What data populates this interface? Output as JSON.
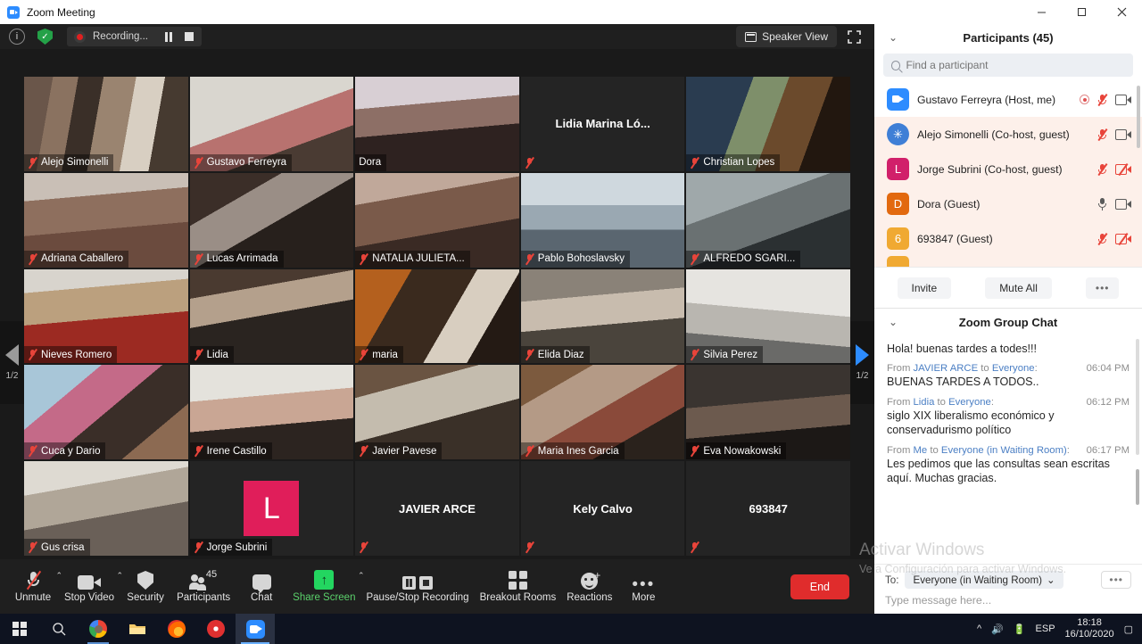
{
  "window": {
    "title": "Zoom Meeting",
    "minimize_icon": "minimize-icon",
    "maximize_icon": "maximize-icon",
    "close_icon": "close-icon"
  },
  "header": {
    "info_icon": "info-icon",
    "encryption_icon": "shield-icon",
    "recording_label": "Recording...",
    "pause_icon": "pause-recording-icon",
    "stop_icon": "stop-recording-icon",
    "view_label": "Speaker View",
    "fullscreen_icon": "fullscreen-icon"
  },
  "gallery": {
    "page_indicator": "1/2",
    "prev_icon": "previous-page-arrow",
    "next_icon": "next-page-arrow",
    "tiles": [
      {
        "name": "Alejo Simonelli",
        "muted": true,
        "video": true,
        "active": false,
        "style": "bookshelf"
      },
      {
        "name": "Gustavo Ferreyra",
        "muted": true,
        "video": true,
        "active": false,
        "style": "pinkshirt"
      },
      {
        "name": "Dora",
        "muted": false,
        "video": true,
        "active": true,
        "style": "dora"
      },
      {
        "name": "Lidia  Marina Ló...",
        "muted": true,
        "video": false,
        "active": false,
        "style": "none"
      },
      {
        "name": "Christian Lopes",
        "muted": true,
        "video": true,
        "active": false,
        "style": "map"
      },
      {
        "name": "Adriana Caballero",
        "muted": true,
        "video": true,
        "active": false,
        "style": "adriana"
      },
      {
        "name": "Lucas Arrimada",
        "muted": true,
        "video": true,
        "active": false,
        "style": "lucas"
      },
      {
        "name": "NATALIA JULIETA...",
        "muted": true,
        "video": true,
        "active": false,
        "style": "natalia"
      },
      {
        "name": "Pablo Bohoslavsky",
        "muted": true,
        "video": true,
        "active": false,
        "style": "pablo"
      },
      {
        "name": "ALFREDO SGARI...",
        "muted": true,
        "video": true,
        "active": false,
        "style": "alfredo"
      },
      {
        "name": "Nieves Romero",
        "muted": true,
        "video": true,
        "active": false,
        "style": "nieves"
      },
      {
        "name": "Lidia",
        "muted": true,
        "video": true,
        "active": false,
        "style": "lidia"
      },
      {
        "name": "maria",
        "muted": true,
        "video": true,
        "active": false,
        "style": "maria"
      },
      {
        "name": "Elida Diaz",
        "muted": true,
        "video": true,
        "active": false,
        "style": "elida"
      },
      {
        "name": "Silvia Perez",
        "muted": true,
        "video": true,
        "active": false,
        "style": "silvia"
      },
      {
        "name": "Cuca y Dario",
        "muted": true,
        "video": true,
        "active": false,
        "style": "cuca"
      },
      {
        "name": "Irene Castillo",
        "muted": true,
        "video": true,
        "active": false,
        "style": "irene"
      },
      {
        "name": "Javier Pavese",
        "muted": true,
        "video": true,
        "active": false,
        "style": "javierp"
      },
      {
        "name": "Maria Ines Garcia",
        "muted": true,
        "video": true,
        "active": false,
        "style": "mariaines"
      },
      {
        "name": "Eva Nowakowski",
        "muted": true,
        "video": true,
        "active": false,
        "style": "eva"
      },
      {
        "name": "Gus crisa",
        "muted": true,
        "video": true,
        "active": false,
        "style": "gus"
      },
      {
        "name": "Jorge Subrini",
        "muted": true,
        "video": false,
        "active": false,
        "style": "avatar-L",
        "avatar_letter": "L",
        "avatar_color": "#e01e5a"
      },
      {
        "name": "JAVIER ARCE",
        "muted": true,
        "video": false,
        "active": false,
        "style": "none"
      },
      {
        "name": "Kely Calvo",
        "muted": true,
        "video": false,
        "active": false,
        "style": "none"
      },
      {
        "name": "693847",
        "muted": true,
        "video": false,
        "active": false,
        "style": "none"
      }
    ]
  },
  "controls": [
    {
      "label": "Unmute",
      "icon": "microphone-muted-icon",
      "caret": true
    },
    {
      "label": "Stop Video",
      "icon": "camera-icon",
      "caret": true
    },
    {
      "label": "Security",
      "icon": "shield-icon",
      "caret": false
    },
    {
      "label": "Participants",
      "icon": "participants-icon",
      "caret": false,
      "badge": "45"
    },
    {
      "label": "Chat",
      "icon": "chat-bubble-icon",
      "caret": false
    },
    {
      "label": "Share Screen",
      "icon": "share-screen-icon",
      "caret": true
    },
    {
      "label": "Pause/Stop Recording",
      "icon": "pause-stop-recording-icon",
      "caret": false
    },
    {
      "label": "Breakout Rooms",
      "icon": "breakout-rooms-icon",
      "caret": false
    },
    {
      "label": "Reactions",
      "icon": "reactions-icon",
      "caret": false
    },
    {
      "label": "More",
      "icon": "more-dots-icon",
      "caret": false
    }
  ],
  "end_button": "End",
  "participants_panel": {
    "title": "Participants (45)",
    "collapse_icon": "chevron-down-icon",
    "search_placeholder": "Find a participant",
    "search_value": "",
    "search_icon": "search-icon",
    "rows": [
      {
        "avatar": "zoom-logo",
        "avatar_letter": "",
        "avatar_color": "#2d8cff",
        "name": "Gustavo Ferreyra  (Host, me)",
        "recording": true,
        "mic": "muted",
        "cam": "on",
        "me": true
      },
      {
        "avatar": "snowflake",
        "avatar_letter": "",
        "avatar_color": "#3f7fd6",
        "name": "Alejo Simonelli (Co-host, guest)",
        "recording": false,
        "mic": "muted",
        "cam": "on",
        "me": false
      },
      {
        "avatar": "letter",
        "avatar_letter": "L",
        "avatar_color": "#d1206a",
        "name": "Jorge Subrini (Co-host, guest)",
        "recording": false,
        "mic": "muted",
        "cam": "off",
        "me": false
      },
      {
        "avatar": "letter",
        "avatar_letter": "D",
        "avatar_color": "#e2690f",
        "name": "Dora (Guest)",
        "recording": false,
        "mic": "on",
        "cam": "on",
        "me": false
      },
      {
        "avatar": "letter",
        "avatar_letter": "6",
        "avatar_color": "#f0a932",
        "name": "693847 (Guest)",
        "recording": false,
        "mic": "muted",
        "cam": "off",
        "me": false
      }
    ],
    "buttons": {
      "invite": "Invite",
      "mute_all": "Mute All",
      "more": "•••"
    }
  },
  "chat_panel": {
    "title": "Zoom Group Chat",
    "collapse_icon": "chevron-down-icon",
    "first_line": "Hola! buenas tardes a todes!!!",
    "messages": [
      {
        "prefix": "From ",
        "sender": "JAVIER ARCE",
        "mid": " to ",
        "target": "Everyone",
        "suffix": ":",
        "time": "06:04 PM",
        "text": "BUENAS TARDES A TODOS.."
      },
      {
        "prefix": "From ",
        "sender": "Lidia",
        "mid": " to ",
        "target": "Everyone",
        "suffix": ":",
        "time": "06:12 PM",
        "text": "siglo XIX liberalismo económico y conservadurismo político"
      },
      {
        "prefix": "From ",
        "sender": "Me",
        "mid": " to ",
        "target": "Everyone (in Waiting Room)",
        "suffix": ":",
        "time": "06:17 PM",
        "text": "Les pedimos que las consultas sean escritas aquí.  Muchas gracias."
      }
    ],
    "to_label": "To:",
    "to_value": "Everyone (in Waiting Room)",
    "to_caret_icon": "chevron-down-icon",
    "more_icon": "more-dots-icon",
    "input_placeholder": "Type message here..."
  },
  "watermark": {
    "line1": "Activar Windows",
    "line2": "Ve a Configuración para activar Windows."
  },
  "taskbar": {
    "start_icon": "windows-start-icon",
    "search_icon": "search-icon",
    "apps": [
      {
        "icon": "chrome-icon",
        "running": true
      },
      {
        "icon": "file-explorer-icon",
        "running": false
      },
      {
        "icon": "firefox-icon",
        "running": false
      },
      {
        "icon": "media-player-icon",
        "running": false
      },
      {
        "icon": "zoom-icon",
        "running": true
      }
    ],
    "tray": {
      "chevron_icon": "show-hidden-icons",
      "volume_icon": "volume-icon",
      "network_icon": "network-battery-icon",
      "language": "ESP",
      "time": "18:18",
      "date": "16/10/2020",
      "notifications_icon": "action-center-icon"
    }
  }
}
